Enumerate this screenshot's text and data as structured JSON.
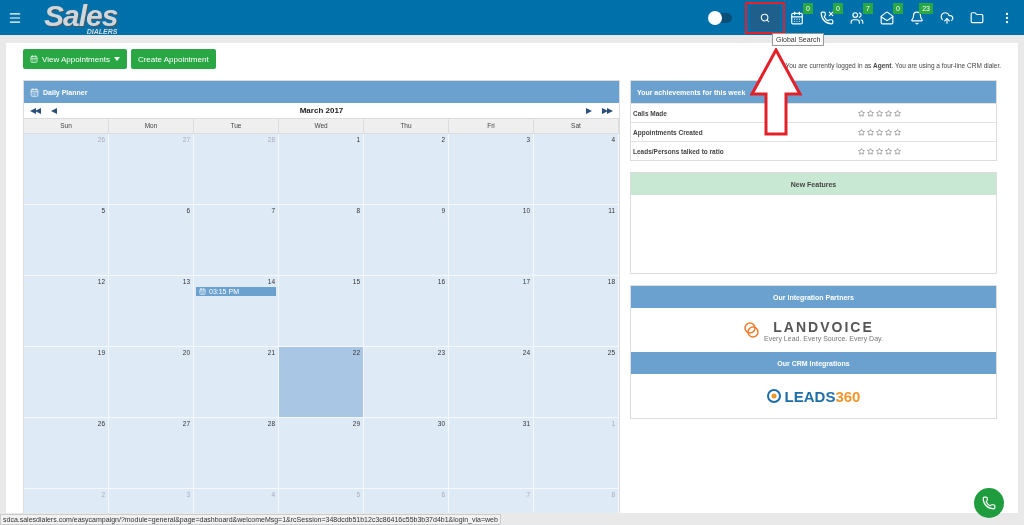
{
  "header": {
    "logo": {
      "text": "Sales",
      "subtext": "DIALERS"
    },
    "toggle": {
      "on": false
    },
    "icons": [
      {
        "kind": "search",
        "highlighted": true
      },
      {
        "kind": "calendar",
        "badge": "0"
      },
      {
        "kind": "phone",
        "badge": "0"
      },
      {
        "kind": "people",
        "badge": "7"
      },
      {
        "kind": "mail",
        "badge": "0"
      },
      {
        "kind": "bell",
        "badge": "23"
      },
      {
        "kind": "upload"
      },
      {
        "kind": "folder"
      },
      {
        "kind": "more"
      }
    ],
    "tooltip": "Global Search"
  },
  "toolbar": {
    "buttons": [
      {
        "label": "View Appointments",
        "dropdown": true
      },
      {
        "label": "Create Appointment",
        "dropdown": false
      }
    ],
    "login_notice": {
      "before": "You are currently logged in as ",
      "user": "Agent",
      "after": ". You are using a four-line CRM dialer."
    }
  },
  "planner": {
    "title": "Daily Planner",
    "month": "March 2017",
    "weekdays": [
      "Sun",
      "Mon",
      "Tue",
      "Wed",
      "Thu",
      "Fri",
      "Sat"
    ],
    "weeks": [
      [
        {
          "day": "26",
          "muted": true,
          "selected": false
        },
        {
          "day": "27",
          "muted": true,
          "selected": false
        },
        {
          "day": "28",
          "muted": true,
          "selected": false
        },
        {
          "day": "1",
          "muted": false,
          "selected": false
        },
        {
          "day": "2",
          "muted": false,
          "selected": false
        },
        {
          "day": "3",
          "muted": false,
          "selected": false
        },
        {
          "day": "4",
          "muted": false,
          "selected": false
        }
      ],
      [
        {
          "day": "5",
          "muted": false,
          "selected": false
        },
        {
          "day": "6",
          "muted": false,
          "selected": false
        },
        {
          "day": "7",
          "muted": false,
          "selected": false
        },
        {
          "day": "8",
          "muted": false,
          "selected": false
        },
        {
          "day": "9",
          "muted": false,
          "selected": false
        },
        {
          "day": "10",
          "muted": false,
          "selected": false
        },
        {
          "day": "11",
          "muted": false,
          "selected": false
        }
      ],
      [
        {
          "day": "12",
          "muted": false,
          "selected": false
        },
        {
          "day": "13",
          "muted": false,
          "selected": false
        },
        {
          "day": "14",
          "muted": false,
          "selected": false,
          "events": [
            "03:15 PM"
          ]
        },
        {
          "day": "15",
          "muted": false,
          "selected": false
        },
        {
          "day": "16",
          "muted": false,
          "selected": false
        },
        {
          "day": "17",
          "muted": false,
          "selected": false
        },
        {
          "day": "18",
          "muted": false,
          "selected": false
        }
      ],
      [
        {
          "day": "19",
          "muted": false,
          "selected": false
        },
        {
          "day": "20",
          "muted": false,
          "selected": false
        },
        {
          "day": "21",
          "muted": false,
          "selected": false
        },
        {
          "day": "22",
          "muted": false,
          "selected": true
        },
        {
          "day": "23",
          "muted": false,
          "selected": false
        },
        {
          "day": "24",
          "muted": false,
          "selected": false
        },
        {
          "day": "25",
          "muted": false,
          "selected": false
        }
      ],
      [
        {
          "day": "26",
          "muted": false,
          "selected": false
        },
        {
          "day": "27",
          "muted": false,
          "selected": false
        },
        {
          "day": "28",
          "muted": false,
          "selected": false
        },
        {
          "day": "29",
          "muted": false,
          "selected": false
        },
        {
          "day": "30",
          "muted": false,
          "selected": false
        },
        {
          "day": "31",
          "muted": false,
          "selected": false
        },
        {
          "day": "1",
          "muted": true,
          "selected": false
        }
      ],
      [
        {
          "day": "2",
          "muted": true,
          "selected": false
        },
        {
          "day": "3",
          "muted": true,
          "selected": false
        },
        {
          "day": "4",
          "muted": true,
          "selected": false
        },
        {
          "day": "5",
          "muted": true,
          "selected": false
        },
        {
          "day": "6",
          "muted": true,
          "selected": false
        },
        {
          "day": "7",
          "muted": true,
          "selected": false
        },
        {
          "day": "8",
          "muted": true,
          "selected": false
        }
      ]
    ]
  },
  "achievements": {
    "title": "Your achievements for this week",
    "rows": [
      {
        "label": "Calls Made",
        "stars": 0
      },
      {
        "label": "Appointments Created",
        "stars": 0
      },
      {
        "label": "Leads/Persons talked to ratio",
        "stars": 0
      }
    ]
  },
  "new_features": {
    "title": "New Features"
  },
  "partners": {
    "title": "Our Integration Partners",
    "logo": {
      "name": "LANDVOICE",
      "tagline": "Every Lead. Every Source. Every Day."
    }
  },
  "crm": {
    "title": "Our CRM Integrations",
    "logo": {
      "name": "LEADS",
      "number": "360"
    }
  },
  "status_bar": {
    "url": "sdca.salesdialers.com/easycampaign/?module=general&page=dashboard&welcomeMsg=1&rcSession=348dcdb51b12c3c86416c55b3b37d4b1&login_via=web"
  }
}
